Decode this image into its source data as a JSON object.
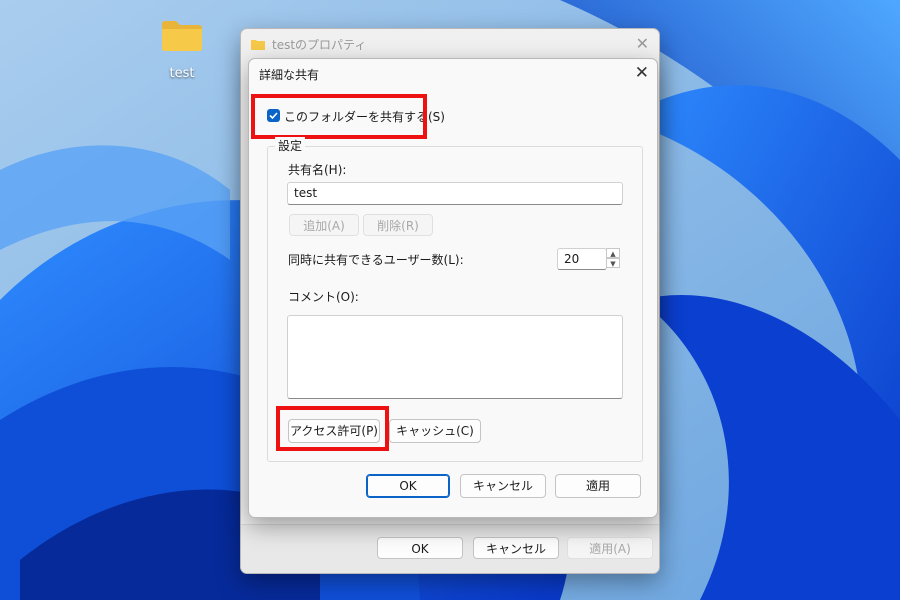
{
  "desktop": {
    "folder_label": "test"
  },
  "properties_window": {
    "title": "testのプロパティ",
    "buttons": {
      "ok": "OK",
      "cancel": "キャンセル",
      "apply": "適用(A)"
    }
  },
  "advanced_sharing": {
    "title": "詳細な共有",
    "share_checkbox": {
      "label": "このフォルダーを共有する(S)",
      "checked": true
    },
    "settings_group": "設定",
    "share_name": {
      "label": "共有名(H):",
      "value": "test"
    },
    "add_button": "追加(A)",
    "remove_button": "削除(R)",
    "user_limit": {
      "label": "同時に共有できるユーザー数(L):",
      "value": "20"
    },
    "comment": {
      "label": "コメント(O):",
      "value": ""
    },
    "permissions_button": "アクセス許可(P)",
    "caching_button": "キャッシュ(C)",
    "buttons": {
      "ok": "OK",
      "cancel": "キャンセル",
      "apply": "適用"
    }
  },
  "colors": {
    "highlight": "#ee1111",
    "accent": "#0a64c8",
    "folder": "#f7c948"
  }
}
